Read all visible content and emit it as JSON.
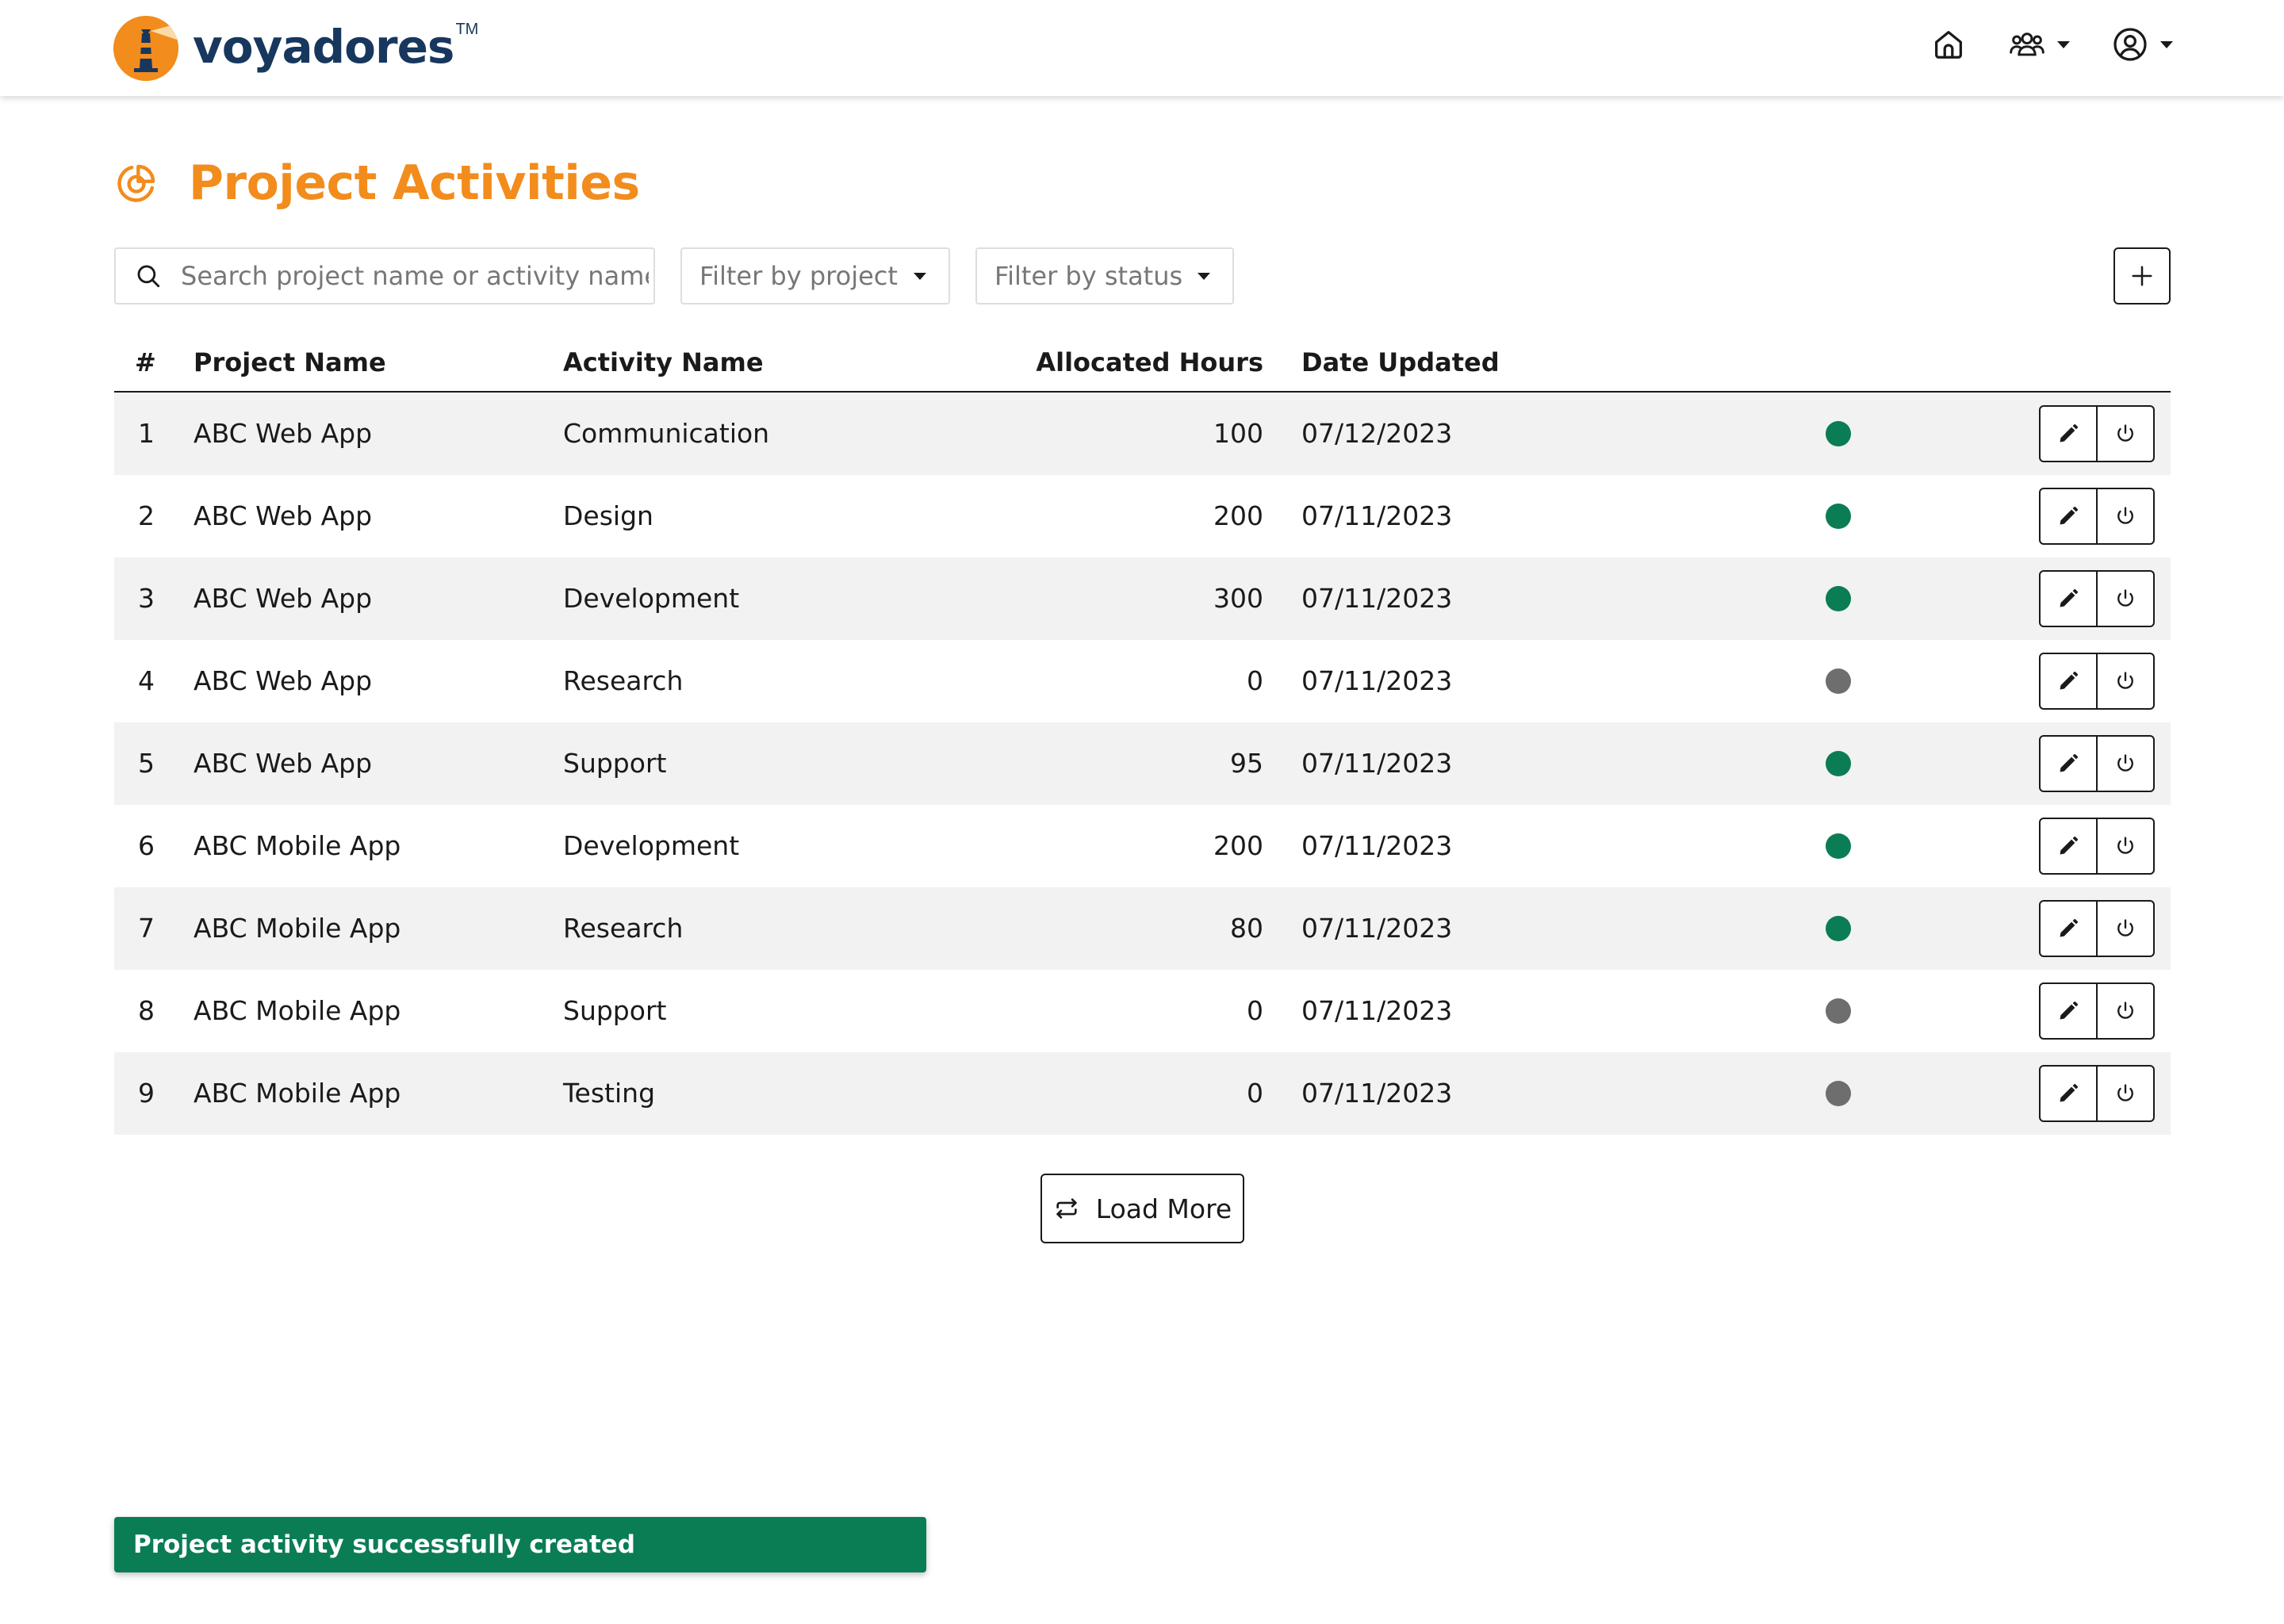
{
  "brand": {
    "name": "voyadores",
    "trademark": "TM",
    "accent": "#f28c1c",
    "brand_color": "#17375e"
  },
  "nav": {
    "items": [
      "home-icon",
      "users-icon",
      "account-icon"
    ]
  },
  "page": {
    "title": "Project Activities",
    "title_icon": "pie-chart-icon"
  },
  "filters": {
    "search_placeholder": "Search project name or activity name",
    "project_filter": "Filter by project",
    "status_filter": "Filter by status",
    "add_icon": "plus-icon"
  },
  "table": {
    "columns": {
      "num": "#",
      "project": "Project Name",
      "activity": "Activity Name",
      "hours": "Allocated Hours",
      "date": "Date Updated"
    },
    "status_colors": {
      "active": "#0a7d55",
      "inactive": "#6e6e6e"
    },
    "rows": [
      {
        "num": "1",
        "project": "ABC Web App",
        "activity": "Communication",
        "hours": "100",
        "date": "07/12/2023",
        "status": "active"
      },
      {
        "num": "2",
        "project": "ABC Web App",
        "activity": "Design",
        "hours": "200",
        "date": "07/11/2023",
        "status": "active"
      },
      {
        "num": "3",
        "project": "ABC Web App",
        "activity": "Development",
        "hours": "300",
        "date": "07/11/2023",
        "status": "active"
      },
      {
        "num": "4",
        "project": "ABC Web App",
        "activity": "Research",
        "hours": "0",
        "date": "07/11/2023",
        "status": "inactive"
      },
      {
        "num": "5",
        "project": "ABC Web App",
        "activity": "Support",
        "hours": "95",
        "date": "07/11/2023",
        "status": "active"
      },
      {
        "num": "6",
        "project": "ABC Mobile App",
        "activity": "Development",
        "hours": "200",
        "date": "07/11/2023",
        "status": "active"
      },
      {
        "num": "7",
        "project": "ABC Mobile App",
        "activity": "Research",
        "hours": "80",
        "date": "07/11/2023",
        "status": "active"
      },
      {
        "num": "8",
        "project": "ABC Mobile App",
        "activity": "Support",
        "hours": "0",
        "date": "07/11/2023",
        "status": "inactive"
      },
      {
        "num": "9",
        "project": "ABC Mobile App",
        "activity": "Testing",
        "hours": "0",
        "date": "07/11/2023",
        "status": "inactive"
      }
    ]
  },
  "load_more": {
    "label": "Load More",
    "icon": "repeat-icon"
  },
  "toast": {
    "message": "Project activity successfully created",
    "color": "#0a7d55"
  }
}
